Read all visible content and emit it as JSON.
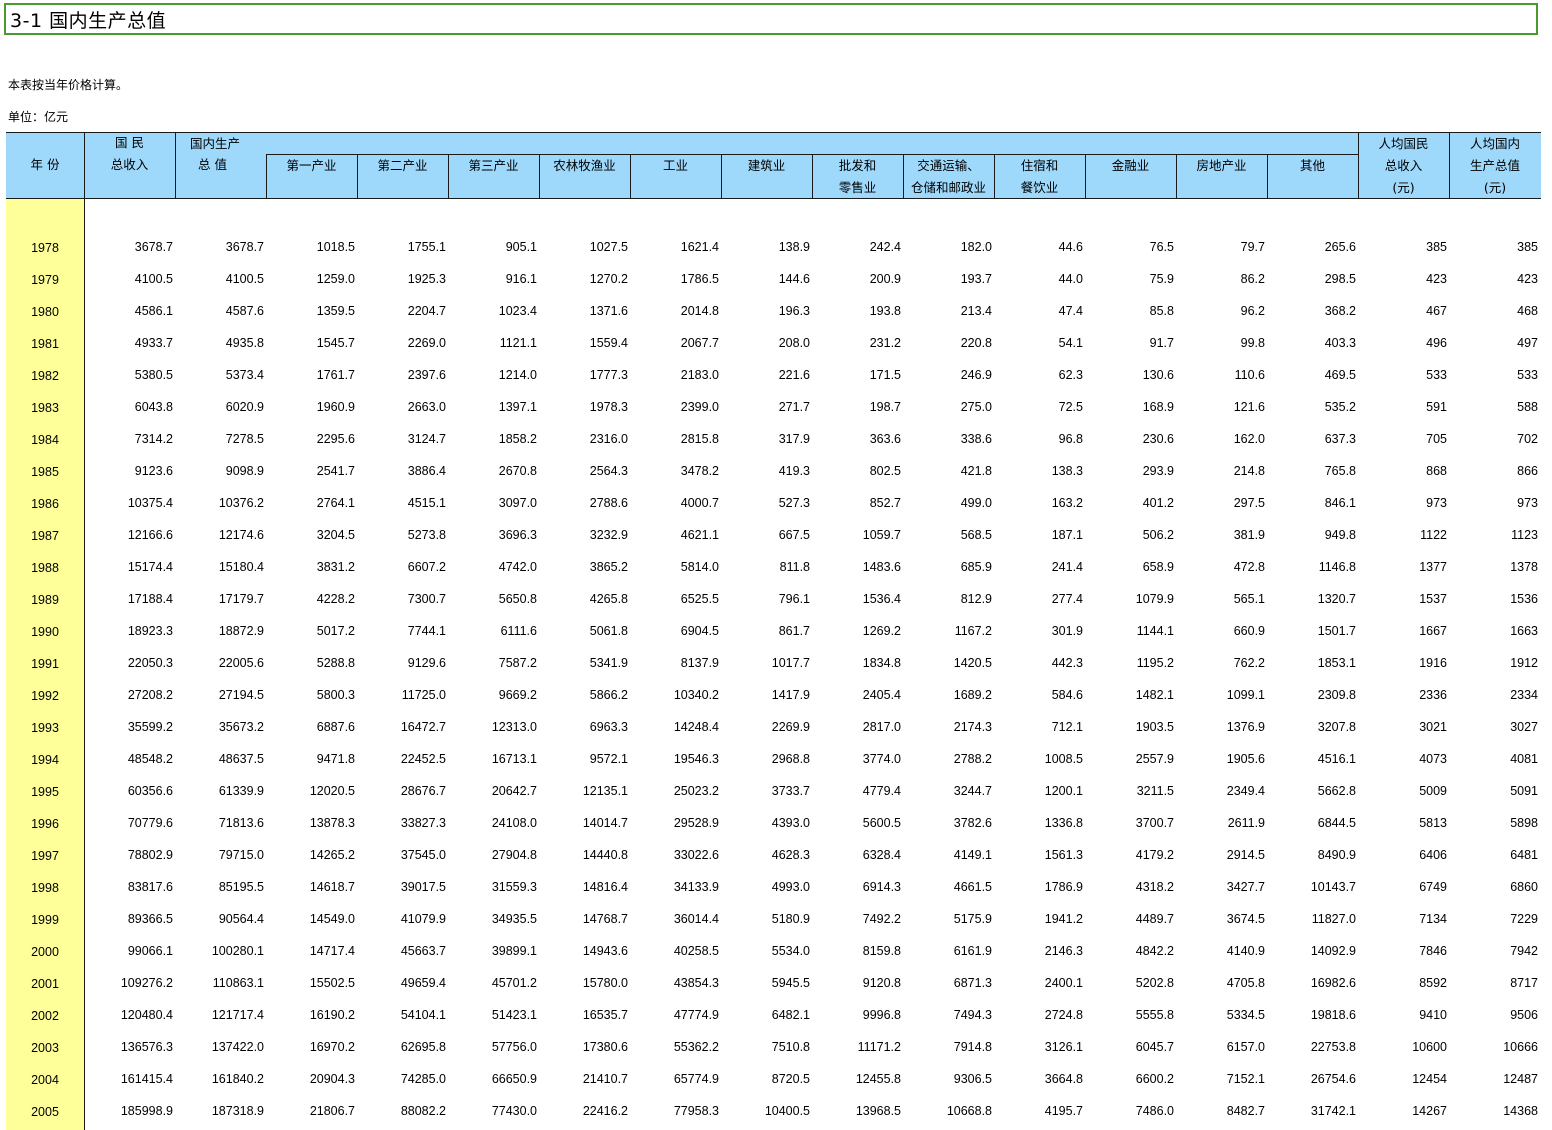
{
  "sheet": {
    "title": "3-1   国内生产总值",
    "note": "本表按当年价格计算。",
    "unit": "单位：亿元"
  },
  "headers": {
    "year": "年 份",
    "gni_l1": "国 民",
    "gni_l2": "总收入",
    "gdp_l1": "国内生产",
    "gdp_l2": "总  值",
    "primary": "第一产业",
    "secondary": "第二产业",
    "tertiary": "第三产业",
    "agri": "农林牧渔业",
    "industry": "工业",
    "construction": "建筑业",
    "trade_l1": "批发和",
    "trade_l2": "零售业",
    "transport_l1": "交通运输、",
    "transport_l2": "仓储和邮政业",
    "hotel_l1": "住宿和",
    "hotel_l2": "餐饮业",
    "finance": "金融业",
    "realestate": "房地产业",
    "other": "其他",
    "pc_gni_l1": "人均国民",
    "pc_gni_l2": "总收入",
    "pc_gni_l3": "(元)",
    "pc_gdp_l1": "人均国内",
    "pc_gdp_l2": "生产总值",
    "pc_gdp_l3": "(元)"
  },
  "rows": [
    [
      "1978",
      "3678.7",
      "3678.7",
      "1018.5",
      "1755.1",
      "905.1",
      "1027.5",
      "1621.4",
      "138.9",
      "242.4",
      "182.0",
      "44.6",
      "76.5",
      "79.7",
      "265.6",
      "385",
      "385"
    ],
    [
      "1979",
      "4100.5",
      "4100.5",
      "1259.0",
      "1925.3",
      "916.1",
      "1270.2",
      "1786.5",
      "144.6",
      "200.9",
      "193.7",
      "44.0",
      "75.9",
      "86.2",
      "298.5",
      "423",
      "423"
    ],
    [
      "1980",
      "4586.1",
      "4587.6",
      "1359.5",
      "2204.7",
      "1023.4",
      "1371.6",
      "2014.8",
      "196.3",
      "193.8",
      "213.4",
      "47.4",
      "85.8",
      "96.2",
      "368.2",
      "467",
      "468"
    ],
    [
      "1981",
      "4933.7",
      "4935.8",
      "1545.7",
      "2269.0",
      "1121.1",
      "1559.4",
      "2067.7",
      "208.0",
      "231.2",
      "220.8",
      "54.1",
      "91.7",
      "99.8",
      "403.3",
      "496",
      "497"
    ],
    [
      "1982",
      "5380.5",
      "5373.4",
      "1761.7",
      "2397.6",
      "1214.0",
      "1777.3",
      "2183.0",
      "221.6",
      "171.5",
      "246.9",
      "62.3",
      "130.6",
      "110.6",
      "469.5",
      "533",
      "533"
    ],
    [
      "1983",
      "6043.8",
      "6020.9",
      "1960.9",
      "2663.0",
      "1397.1",
      "1978.3",
      "2399.0",
      "271.7",
      "198.7",
      "275.0",
      "72.5",
      "168.9",
      "121.6",
      "535.2",
      "591",
      "588"
    ],
    [
      "1984",
      "7314.2",
      "7278.5",
      "2295.6",
      "3124.7",
      "1858.2",
      "2316.0",
      "2815.8",
      "317.9",
      "363.6",
      "338.6",
      "96.8",
      "230.6",
      "162.0",
      "637.3",
      "705",
      "702"
    ],
    [
      "1985",
      "9123.6",
      "9098.9",
      "2541.7",
      "3886.4",
      "2670.8",
      "2564.3",
      "3478.2",
      "419.3",
      "802.5",
      "421.8",
      "138.3",
      "293.9",
      "214.8",
      "765.8",
      "868",
      "866"
    ],
    [
      "1986",
      "10375.4",
      "10376.2",
      "2764.1",
      "4515.1",
      "3097.0",
      "2788.6",
      "4000.7",
      "527.3",
      "852.7",
      "499.0",
      "163.2",
      "401.2",
      "297.5",
      "846.1",
      "973",
      "973"
    ],
    [
      "1987",
      "12166.6",
      "12174.6",
      "3204.5",
      "5273.8",
      "3696.3",
      "3232.9",
      "4621.1",
      "667.5",
      "1059.7",
      "568.5",
      "187.1",
      "506.2",
      "381.9",
      "949.8",
      "1122",
      "1123"
    ],
    [
      "1988",
      "15174.4",
      "15180.4",
      "3831.2",
      "6607.2",
      "4742.0",
      "3865.2",
      "5814.0",
      "811.8",
      "1483.6",
      "685.9",
      "241.4",
      "658.9",
      "472.8",
      "1146.8",
      "1377",
      "1378"
    ],
    [
      "1989",
      "17188.4",
      "17179.7",
      "4228.2",
      "7300.7",
      "5650.8",
      "4265.8",
      "6525.5",
      "796.1",
      "1536.4",
      "812.9",
      "277.4",
      "1079.9",
      "565.1",
      "1320.7",
      "1537",
      "1536"
    ],
    [
      "1990",
      "18923.3",
      "18872.9",
      "5017.2",
      "7744.1",
      "6111.6",
      "5061.8",
      "6904.5",
      "861.7",
      "1269.2",
      "1167.2",
      "301.9",
      "1144.1",
      "660.9",
      "1501.7",
      "1667",
      "1663"
    ],
    [
      "1991",
      "22050.3",
      "22005.6",
      "5288.8",
      "9129.6",
      "7587.2",
      "5341.9",
      "8137.9",
      "1017.7",
      "1834.8",
      "1420.5",
      "442.3",
      "1195.2",
      "762.2",
      "1853.1",
      "1916",
      "1912"
    ],
    [
      "1992",
      "27208.2",
      "27194.5",
      "5800.3",
      "11725.0",
      "9669.2",
      "5866.2",
      "10340.2",
      "1417.9",
      "2405.4",
      "1689.2",
      "584.6",
      "1482.1",
      "1099.1",
      "2309.8",
      "2336",
      "2334"
    ],
    [
      "1993",
      "35599.2",
      "35673.2",
      "6887.6",
      "16472.7",
      "12313.0",
      "6963.3",
      "14248.4",
      "2269.9",
      "2817.0",
      "2174.3",
      "712.1",
      "1903.5",
      "1376.9",
      "3207.8",
      "3021",
      "3027"
    ],
    [
      "1994",
      "48548.2",
      "48637.5",
      "9471.8",
      "22452.5",
      "16713.1",
      "9572.1",
      "19546.3",
      "2968.8",
      "3774.0",
      "2788.2",
      "1008.5",
      "2557.9",
      "1905.6",
      "4516.1",
      "4073",
      "4081"
    ],
    [
      "1995",
      "60356.6",
      "61339.9",
      "12020.5",
      "28676.7",
      "20642.7",
      "12135.1",
      "25023.2",
      "3733.7",
      "4779.4",
      "3244.7",
      "1200.1",
      "3211.5",
      "2349.4",
      "5662.8",
      "5009",
      "5091"
    ],
    [
      "1996",
      "70779.6",
      "71813.6",
      "13878.3",
      "33827.3",
      "24108.0",
      "14014.7",
      "29528.9",
      "4393.0",
      "5600.5",
      "3782.6",
      "1336.8",
      "3700.7",
      "2611.9",
      "6844.5",
      "5813",
      "5898"
    ],
    [
      "1997",
      "78802.9",
      "79715.0",
      "14265.2",
      "37545.0",
      "27904.8",
      "14440.8",
      "33022.6",
      "4628.3",
      "6328.4",
      "4149.1",
      "1561.3",
      "4179.2",
      "2914.5",
      "8490.9",
      "6406",
      "6481"
    ],
    [
      "1998",
      "83817.6",
      "85195.5",
      "14618.7",
      "39017.5",
      "31559.3",
      "14816.4",
      "34133.9",
      "4993.0",
      "6914.3",
      "4661.5",
      "1786.9",
      "4318.2",
      "3427.7",
      "10143.7",
      "6749",
      "6860"
    ],
    [
      "1999",
      "89366.5",
      "90564.4",
      "14549.0",
      "41079.9",
      "34935.5",
      "14768.7",
      "36014.4",
      "5180.9",
      "7492.2",
      "5175.9",
      "1941.2",
      "4489.7",
      "3674.5",
      "11827.0",
      "7134",
      "7229"
    ],
    [
      "2000",
      "99066.1",
      "100280.1",
      "14717.4",
      "45663.7",
      "39899.1",
      "14943.6",
      "40258.5",
      "5534.0",
      "8159.8",
      "6161.9",
      "2146.3",
      "4842.2",
      "4140.9",
      "14092.9",
      "7846",
      "7942"
    ],
    [
      "2001",
      "109276.2",
      "110863.1",
      "15502.5",
      "49659.4",
      "45701.2",
      "15780.0",
      "43854.3",
      "5945.5",
      "9120.8",
      "6871.3",
      "2400.1",
      "5202.8",
      "4705.8",
      "16982.6",
      "8592",
      "8717"
    ],
    [
      "2002",
      "120480.4",
      "121717.4",
      "16190.2",
      "54104.1",
      "51423.1",
      "16535.7",
      "47774.9",
      "6482.1",
      "9996.8",
      "7494.3",
      "2724.8",
      "5555.8",
      "5334.5",
      "19818.6",
      "9410",
      "9506"
    ],
    [
      "2003",
      "136576.3",
      "137422.0",
      "16970.2",
      "62695.8",
      "57756.0",
      "17380.6",
      "55362.2",
      "7510.8",
      "11171.2",
      "7914.8",
      "3126.1",
      "6045.7",
      "6157.0",
      "22753.8",
      "10600",
      "10666"
    ],
    [
      "2004",
      "161415.4",
      "161840.2",
      "20904.3",
      "74285.0",
      "66650.9",
      "21410.7",
      "65774.9",
      "8720.5",
      "12455.8",
      "9306.5",
      "3664.8",
      "6600.2",
      "7152.1",
      "26754.6",
      "12454",
      "12487"
    ],
    [
      "2005",
      "185998.9",
      "187318.9",
      "21806.7",
      "88082.2",
      "77430.0",
      "22416.2",
      "77958.3",
      "10400.5",
      "13968.5",
      "10668.8",
      "4195.7",
      "7486.0",
      "8482.7",
      "31742.1",
      "14267",
      "14368"
    ]
  ]
}
